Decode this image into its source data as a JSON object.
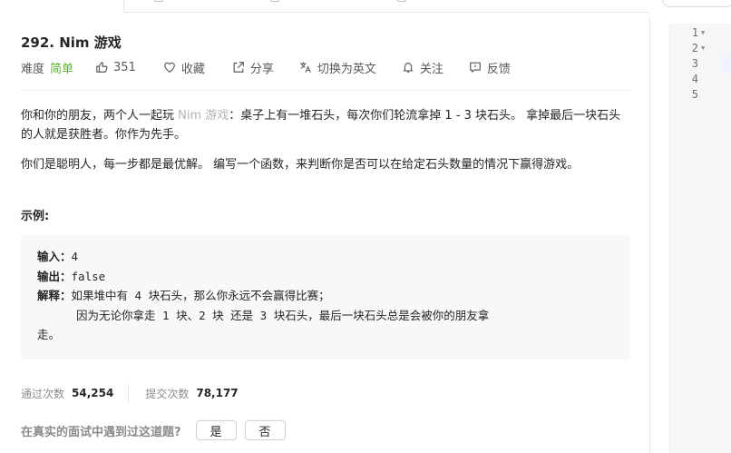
{
  "problem": {
    "title": "292. Nim 游戏",
    "difficulty_label": "难度",
    "difficulty_value": "简单",
    "likes": "351",
    "actions": {
      "favorite": "收藏",
      "share": "分享",
      "switch_lang": "切换为英文",
      "follow": "关注",
      "feedback": "反馈"
    },
    "description": {
      "p1_before": "你和你的朋友，两个人一起玩 ",
      "p1_link": "Nim 游戏",
      "p1_after": "：桌子上有一堆石头，每次你们轮流拿掉 1 - 3 块石头。 拿掉最后一块石头的人就是获胜者。你作为先手。",
      "p2": "你们是聪明人，每一步都是最优解。 编写一个函数，来判断你是否可以在给定石头数量的情况下赢得游戏。",
      "example_title": "示例:"
    },
    "example": {
      "input_label": "输入：",
      "input_value": "4",
      "output_label": "输出：",
      "output_value": "false",
      "explain_label": "解释：",
      "explain_line1": "如果堆中有 4 块石头，那么你永远不会赢得比赛；",
      "explain_line2": "因为无论你拿走 1 块、2 块 还是 3 块石头，最后一块石头总是会被你的朋友拿",
      "explain_line3": "走。"
    },
    "stats": {
      "accepted_label": "通过次数",
      "accepted_value": "54,254",
      "submissions_label": "提交次数",
      "submissions_value": "78,177"
    },
    "survey": {
      "question": "在真实的面试中遇到过这道题?",
      "yes": "是",
      "no": "否"
    }
  },
  "editor": {
    "line_numbers": [
      "1",
      "2",
      "3",
      "4",
      "5"
    ]
  },
  "colors": {
    "difficulty_easy": "#5ab726",
    "muted_text": "#8c8c8c",
    "code_bg": "#f7f8fa"
  }
}
